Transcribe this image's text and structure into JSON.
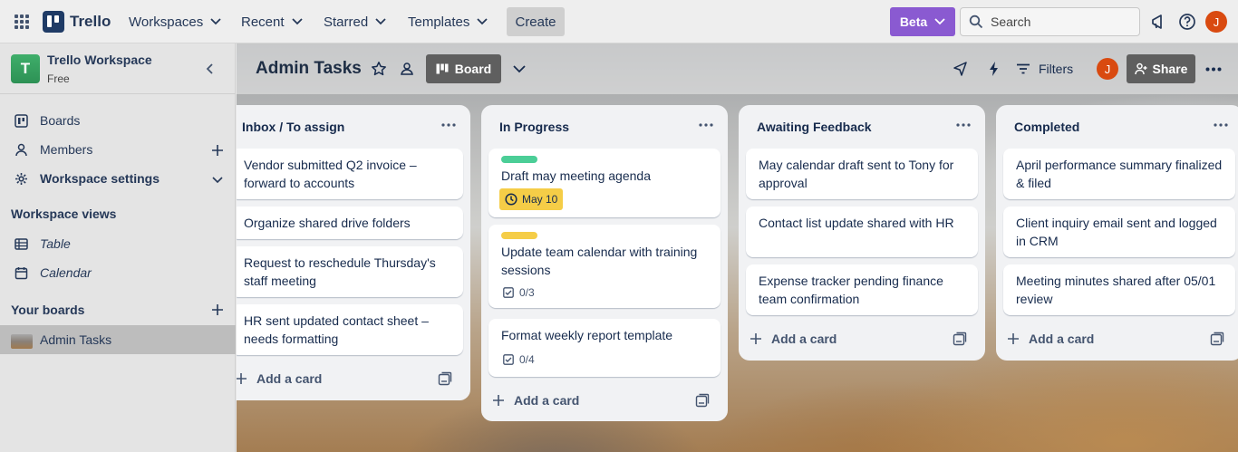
{
  "topbar": {
    "app_name": "Trello",
    "nav": [
      "Workspaces",
      "Recent",
      "Starred",
      "Templates"
    ],
    "create_label": "Create",
    "beta_label": "Beta",
    "search_placeholder": "Search",
    "user_initial": "J"
  },
  "sidebar": {
    "workspace_initial": "T",
    "workspace_name": "Trello Workspace",
    "workspace_plan": "Free",
    "items": [
      {
        "label": "Boards",
        "icon": "board-icon"
      },
      {
        "label": "Members",
        "icon": "person-icon"
      },
      {
        "label": "Workspace settings",
        "icon": "gear-icon"
      }
    ],
    "views_heading": "Workspace views",
    "views": [
      {
        "label": "Table",
        "icon": "table-icon"
      },
      {
        "label": "Calendar",
        "icon": "calendar-icon"
      }
    ],
    "boards_heading": "Your boards",
    "boards": [
      {
        "label": "Admin Tasks"
      }
    ]
  },
  "board": {
    "title": "Admin Tasks",
    "view_label": "Board",
    "filters_label": "Filters",
    "share_label": "Share",
    "member_initial": "J"
  },
  "lists": [
    {
      "title": "Inbox / To assign",
      "cards": [
        {
          "text": "Vendor submitted Q2 invoice – forward to accounts"
        },
        {
          "text": "Organize shared drive folders"
        },
        {
          "text": "Request to reschedule Thursday's staff meeting"
        },
        {
          "text": "HR sent updated contact sheet – needs formatting"
        }
      ],
      "add_label": "Add a card"
    },
    {
      "title": "In Progress",
      "cards": [
        {
          "text": "Draft may meeting agenda",
          "label_color": "#4bce97",
          "due": "May 10"
        },
        {
          "text": "Update team calendar with training sessions",
          "label_color": "#f5cd47",
          "checklist": "0/3"
        },
        {
          "text": "Format weekly report template",
          "checklist": "0/4"
        }
      ],
      "add_label": "Add a card"
    },
    {
      "title": "Awaiting Feedback",
      "cards": [
        {
          "text": "May calendar draft sent to Tony for approval"
        },
        {
          "text": "Contact list update shared with HR"
        },
        {
          "text": "Expense tracker pending finance team confirmation"
        }
      ],
      "add_label": "Add a card"
    },
    {
      "title": "Completed",
      "cards": [
        {
          "text": "April performance summary finalized & filed"
        },
        {
          "text": "Client inquiry email sent and logged in CRM"
        },
        {
          "text": "Meeting minutes shared after 05/01 review"
        }
      ],
      "add_label": "Add a card"
    }
  ],
  "colors": {
    "beta": "#8a5ad1",
    "green_label": "#4bce97",
    "yellow_label": "#f5cd47",
    "avatar": "#d94a10"
  }
}
